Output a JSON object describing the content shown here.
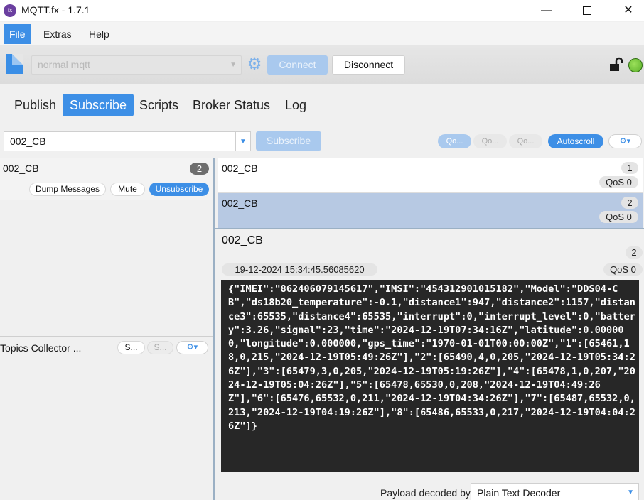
{
  "window": {
    "title": "MQTT.fx - 1.7.1",
    "app_icon": "mqttfx-logo-icon",
    "controls": {
      "minimize": "—",
      "close": "✕"
    }
  },
  "menu": {
    "items": [
      "File",
      "Extras",
      "Help"
    ],
    "active": "File"
  },
  "toolbar": {
    "profile_value": "normal mqtt",
    "connect_label": "Connect",
    "disconnect_label": "Disconnect",
    "status_color": "#5bb02a"
  },
  "tabs": [
    {
      "label": "Publish"
    },
    {
      "label": "Subscribe",
      "active": true
    },
    {
      "label": "Scripts"
    },
    {
      "label": "Broker Status"
    },
    {
      "label": "Log"
    }
  ],
  "subscribe_bar": {
    "topic_value": "002_CB",
    "subscribe_label": "Subscribe",
    "qos_buttons": [
      "Qo...",
      "Qo...",
      "Qo..."
    ],
    "autoscroll_label": "Autoscroll"
  },
  "subscriptions": [
    {
      "topic": "002_CB",
      "count": "2",
      "dump_label": "Dump Messages",
      "mute_label": "Mute",
      "unsubscribe_label": "Unsubscribe"
    }
  ],
  "topics_collector": {
    "title": "Topics Collector ...",
    "button1": "S...",
    "button2": "S..."
  },
  "messages": [
    {
      "topic": "002_CB",
      "num": "1",
      "qos": "QoS 0"
    },
    {
      "topic": "002_CB",
      "num": "2",
      "qos": "QoS 0",
      "selected": true
    }
  ],
  "detail": {
    "topic": "002_CB",
    "num": "2",
    "timestamp": "19-12-2024  15:34:45.56085620",
    "qos": "QoS 0",
    "payload": "{\"IMEI\":\"862406079145617\",\"IMSI\":\"454312901015182\",\"Model\":\"DDS04-CB\",\"ds18b20_temperature\":-0.1,\"distance1\":947,\"distance2\":1157,\"distance3\":65535,\"distance4\":65535,\"interrupt\":0,\"interrupt_level\":0,\"battery\":3.26,\"signal\":23,\"time\":\"2024-12-19T07:34:16Z\",\"latitude\":0.000000,\"longitude\":0.000000,\"gps_time\":\"1970-01-01T00:00:00Z\",\"1\":[65461,18,0,215,\"2024-12-19T05:49:26Z\"],\"2\":[65490,4,0,205,\"2024-12-19T05:34:26Z\"],\"3\":[65479,3,0,205,\"2024-12-19T05:19:26Z\"],\"4\":[65478,1,0,207,\"2024-12-19T05:04:26Z\"],\"5\":[65478,65530,0,208,\"2024-12-19T04:49:26Z\"],\"6\":[65476,65532,0,211,\"2024-12-19T04:34:26Z\"],\"7\":[65487,65532,0,213,\"2024-12-19T04:19:26Z\"],\"8\":[65486,65533,0,217,\"2024-12-19T04:04:26Z\"]}",
    "decoded_by_label": "Payload decoded by",
    "decoder_value": "Plain Text Decoder"
  }
}
